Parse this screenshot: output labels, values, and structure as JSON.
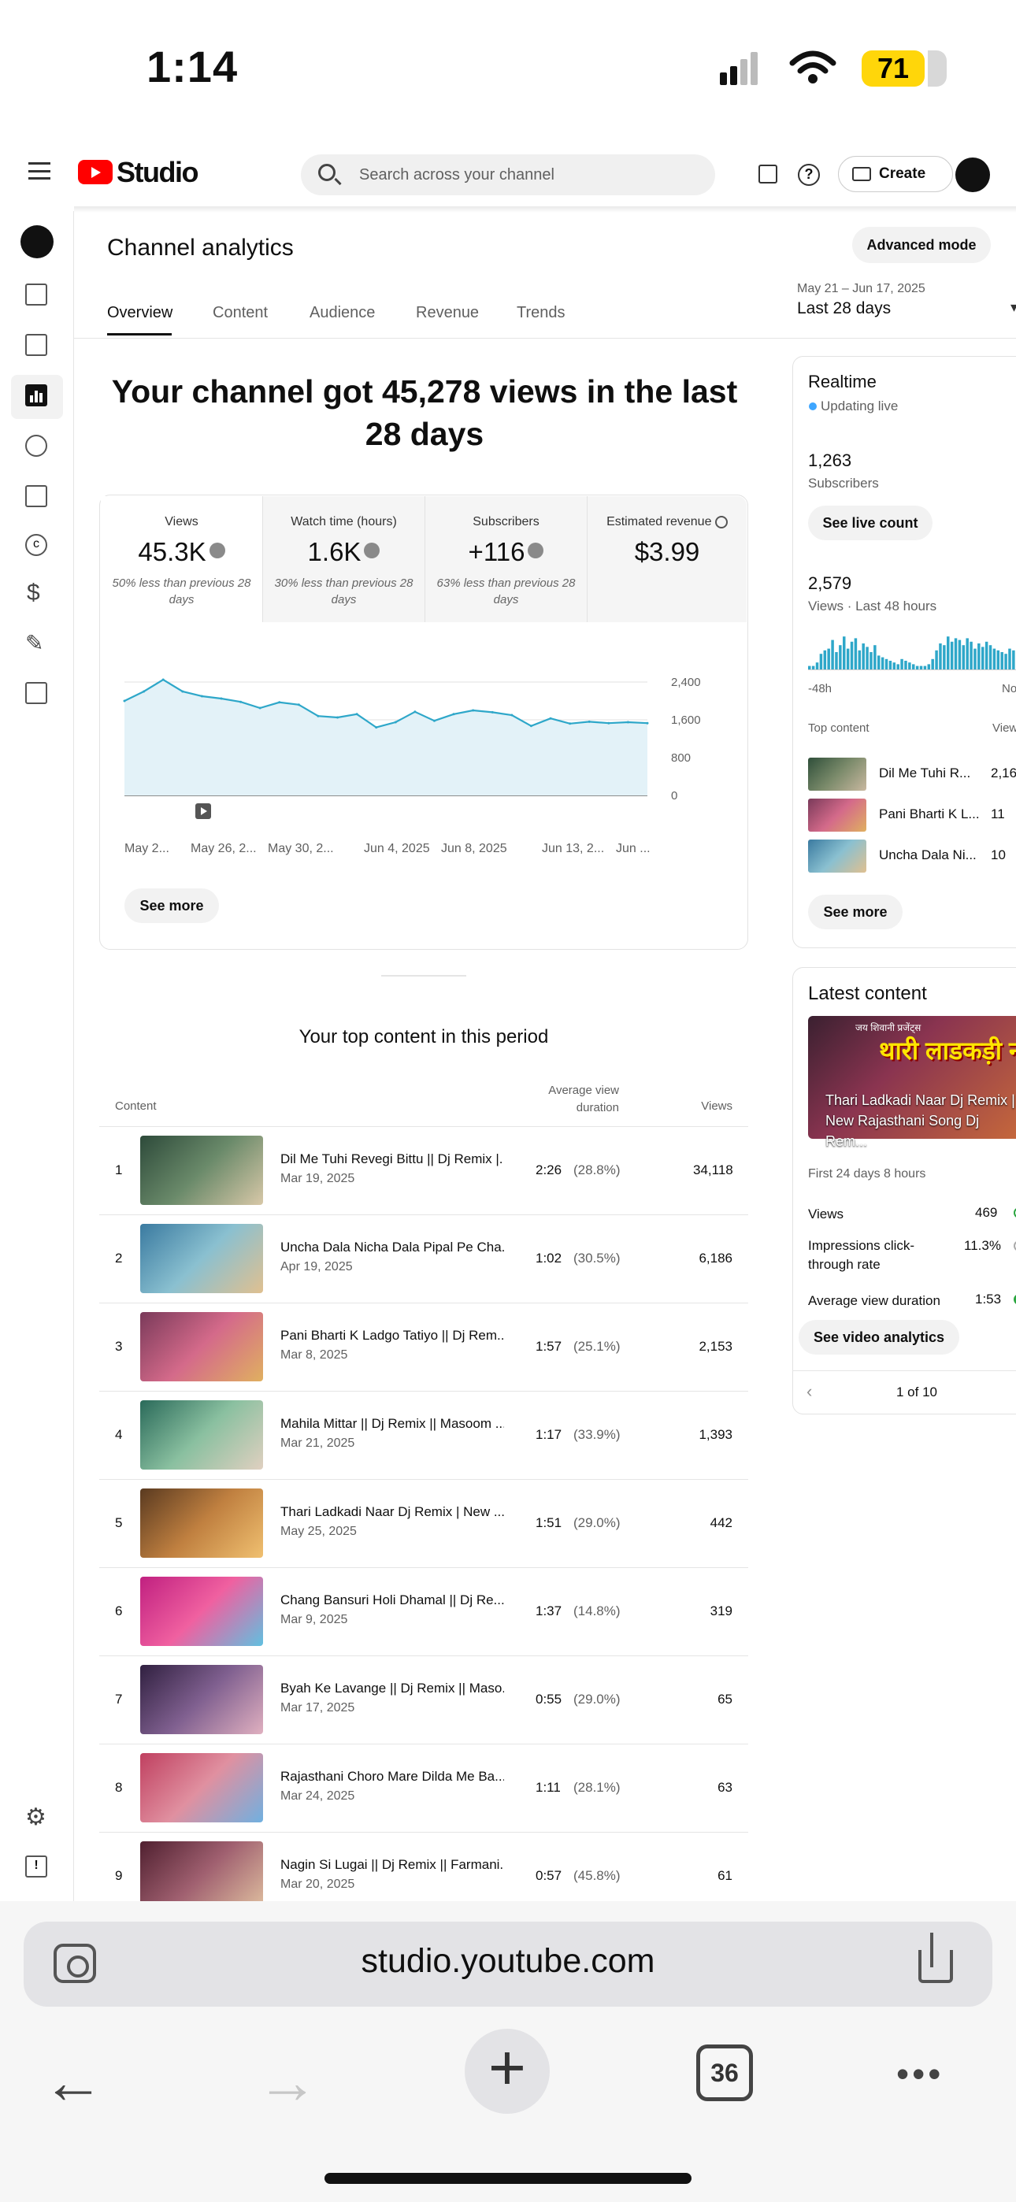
{
  "status_bar": {
    "time": "1:14",
    "battery": "71"
  },
  "topbar": {
    "studio_label": "Studio",
    "search_placeholder": "Search across your channel",
    "create_label": "Create"
  },
  "header": {
    "title": "Channel analytics",
    "advanced_mode": "Advanced mode",
    "tabs": [
      "Overview",
      "Content",
      "Audience",
      "Revenue",
      "Trends"
    ],
    "date_range": "May 21 – Jun 17, 2025",
    "date_label": "Last 28 days"
  },
  "headline": "Your channel got 45,278 views in the last 28 days",
  "metrics": [
    {
      "label": "Views",
      "value": "45.3K",
      "note": "50% less than previous 28 days"
    },
    {
      "label": "Watch time (hours)",
      "value": "1.6K",
      "note": "30% less than previous 28 days"
    },
    {
      "label": "Subscribers",
      "value": "+116",
      "note": "63% less than previous 28 days"
    },
    {
      "label": "Estimated revenue",
      "value": "$3.99",
      "note": ""
    }
  ],
  "chart_data": {
    "type": "area",
    "x": [
      "May 21",
      "May 22",
      "May 23",
      "May 24",
      "May 25",
      "May 26",
      "May 27",
      "May 28",
      "May 29",
      "May 30",
      "May 31",
      "Jun 1",
      "Jun 2",
      "Jun 3",
      "Jun 4",
      "Jun 5",
      "Jun 6",
      "Jun 7",
      "Jun 8",
      "Jun 9",
      "Jun 10",
      "Jun 11",
      "Jun 12",
      "Jun 13",
      "Jun 14",
      "Jun 15",
      "Jun 16",
      "Jun 17"
    ],
    "y": [
      2000,
      2200,
      2450,
      2200,
      2100,
      2050,
      1980,
      1850,
      1970,
      1920,
      1680,
      1650,
      1720,
      1440,
      1550,
      1770,
      1580,
      1720,
      1800,
      1760,
      1700,
      1470,
      1630,
      1520,
      1560,
      1530,
      1550,
      1530
    ],
    "tick_labels": [
      "May 2...",
      "May 26, 2...",
      "May 30, 2...",
      "Jun 4, 2025",
      "Jun 8, 2025",
      "Jun 13, 2...",
      "Jun ..."
    ],
    "y_ticks": [
      "0",
      "800",
      "1,600",
      "2,400"
    ],
    "ylim": [
      0,
      2400
    ],
    "color": "#2ea7c9"
  },
  "see_more": "See more",
  "top_content": {
    "title": "Your top content in this period",
    "col_content": "Content",
    "col_duration": "Average view duration",
    "col_views": "Views",
    "rows": [
      {
        "n": "1",
        "title": "Dil Me Tuhi Revegi Bittu || Dj Remix |...",
        "date": "Mar 19, 2025",
        "dur": "2:26",
        "pct": "(28.8%)",
        "views": "34,118"
      },
      {
        "n": "2",
        "title": "Uncha Dala Nicha Dala Pipal Pe Cha...",
        "date": "Apr 19, 2025",
        "dur": "1:02",
        "pct": "(30.5%)",
        "views": "6,186"
      },
      {
        "n": "3",
        "title": "Pani Bharti K Ladgo Tatiyo || Dj Rem...",
        "date": "Mar 8, 2025",
        "dur": "1:57",
        "pct": "(25.1%)",
        "views": "2,153"
      },
      {
        "n": "4",
        "title": "Mahila Mittar || Dj Remix || Masoom ...",
        "date": "Mar 21, 2025",
        "dur": "1:17",
        "pct": "(33.9%)",
        "views": "1,393"
      },
      {
        "n": "5",
        "title": "Thari Ladkadi Naar Dj Remix | New ...",
        "date": "May 25, 2025",
        "dur": "1:51",
        "pct": "(29.0%)",
        "views": "442"
      },
      {
        "n": "6",
        "title": "Chang Bansuri Holi Dhamal || Dj Re...",
        "date": "Mar 9, 2025",
        "dur": "1:37",
        "pct": "(14.8%)",
        "views": "319"
      },
      {
        "n": "7",
        "title": "Byah Ke Lavange || Dj Remix || Maso...",
        "date": "Mar 17, 2025",
        "dur": "0:55",
        "pct": "(29.0%)",
        "views": "65"
      },
      {
        "n": "8",
        "title": "Rajasthani Choro Mare Dilda Me Ba...",
        "date": "Mar 24, 2025",
        "dur": "1:11",
        "pct": "(28.1%)",
        "views": "63"
      },
      {
        "n": "9",
        "title": "Nagin Si Lugai || Dj Remix || Farmani...",
        "date": "Mar 20, 2025",
        "dur": "0:57",
        "pct": "(45.8%)",
        "views": "61"
      }
    ]
  },
  "realtime": {
    "title": "Realtime",
    "updating": "Updating live",
    "subscribers": "1,263",
    "subscribers_label": "Subscribers",
    "live_count": "See live count",
    "views": "2,579",
    "views_label": "Views · Last 48 hours",
    "axis_left": "-48h",
    "axis_right": "No",
    "bars": [
      0.1,
      0.1,
      0.2,
      0.45,
      0.55,
      0.6,
      0.85,
      0.5,
      0.7,
      0.95,
      0.6,
      0.8,
      0.9,
      0.55,
      0.75,
      0.65,
      0.5,
      0.7,
      0.4,
      0.35,
      0.3,
      0.25,
      0.2,
      0.15,
      0.3,
      0.25,
      0.2,
      0.15,
      0.1,
      0.1,
      0.1,
      0.15,
      0.3,
      0.55,
      0.75,
      0.7,
      0.95,
      0.8,
      0.9,
      0.85,
      0.7,
      0.9,
      0.8,
      0.6,
      0.75,
      0.65,
      0.8,
      0.7,
      0.6,
      0.55,
      0.5,
      0.45,
      0.6,
      0.55
    ],
    "top_content_label": "Top content",
    "views_col": "View",
    "top": [
      {
        "title": "Dil Me Tuhi R...",
        "views": "2,16"
      },
      {
        "title": "Pani Bharti K L...",
        "views": "11"
      },
      {
        "title": "Uncha Dala Ni...",
        "views": "10"
      }
    ],
    "see_more": "See more"
  },
  "latest": {
    "title": "Latest content",
    "caption": "Thari Ladkadi Naar Dj Remix | New Rajasthani Song Dj Rem...",
    "thumb_text": "थारी लाडकड़ी ना",
    "thumb_sub": "जय शिवानी प्रजेंट्स",
    "first": "First 24 days 8 hours",
    "stats": [
      {
        "label": "Views",
        "value": "469"
      },
      {
        "label": "Impressions click-through rate",
        "value": "11.3%"
      },
      {
        "label": "Average view duration",
        "value": "1:53"
      }
    ],
    "analytics_btn": "See video analytics",
    "pager": "1 of 10"
  },
  "safari": {
    "url": "studio.youtube.com",
    "tabs_count": "36",
    "dots": "•••"
  }
}
